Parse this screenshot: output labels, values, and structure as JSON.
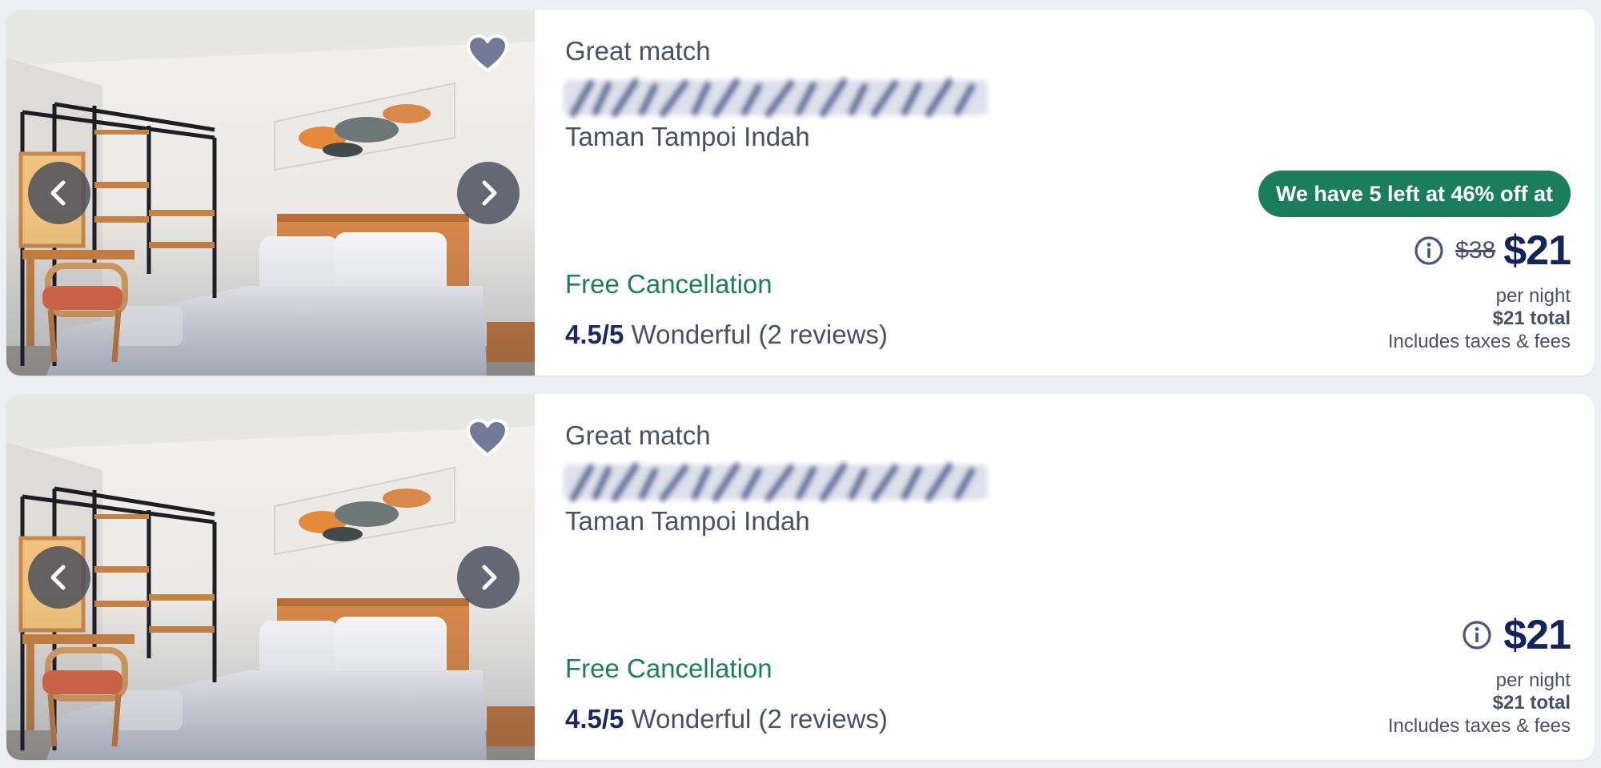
{
  "listings": [
    {
      "match_label": "Great match",
      "location": "Taman Tampoi Indah",
      "cancellation": "Free Cancellation",
      "rating_score": "4.5/5",
      "rating_text": "Wonderful (2 reviews)",
      "deal_badge": "We have 5 left at 46% off at",
      "old_price": "$38",
      "price": "$21",
      "per_night": "per night",
      "total": "$21 total",
      "taxes": "Includes taxes & fees"
    },
    {
      "match_label": "Great match",
      "location": "Taman Tampoi Indah",
      "cancellation": "Free Cancellation",
      "rating_score": "4.5/5",
      "rating_text": "Wonderful (2 reviews)",
      "price": "$21",
      "per_night": "per night",
      "total": "$21 total",
      "taxes": "Includes taxes & fees"
    }
  ],
  "icons": {
    "favorite": "heart-icon",
    "previous": "chevron-left-icon",
    "next": "chevron-right-icon",
    "price_info": "info-icon"
  },
  "colors": {
    "accent_green": "#1a7d5c",
    "price_navy": "#13245a",
    "text_gray": "#4a5068",
    "background": "#eceef1"
  }
}
